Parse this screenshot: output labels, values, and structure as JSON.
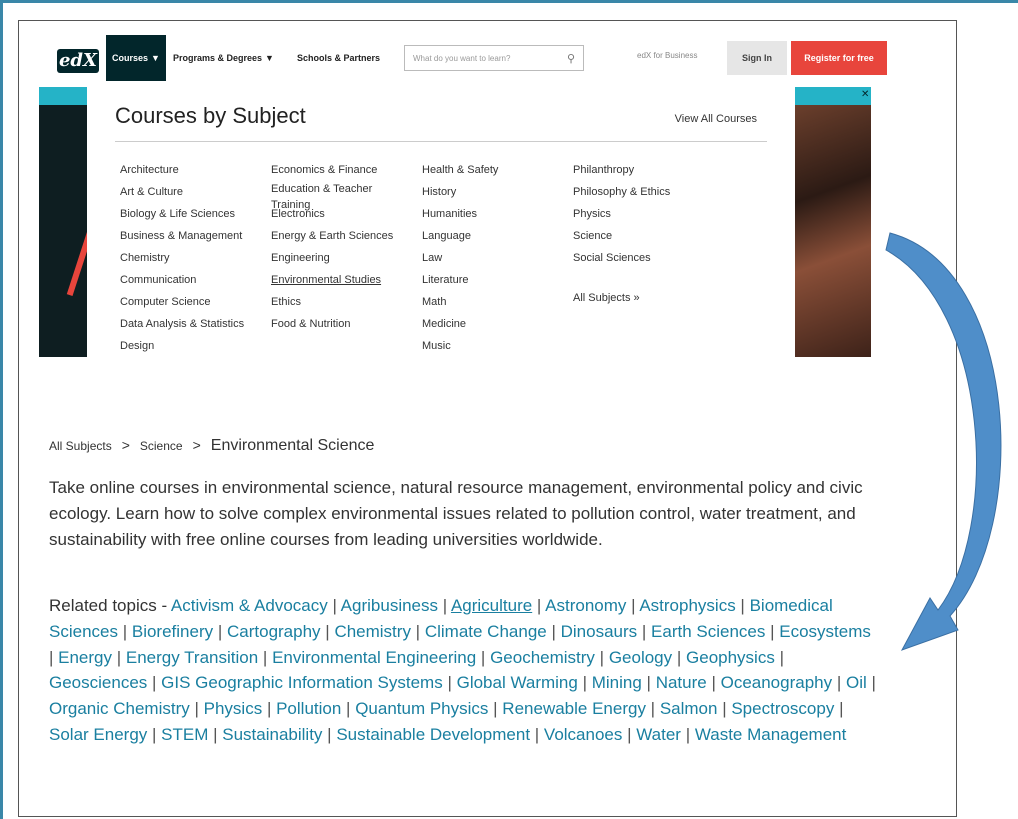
{
  "header": {
    "logo_text": "edX",
    "nav": {
      "courses": "Courses",
      "programs": "Programs & Degrees",
      "schools": "Schools & Partners"
    },
    "search_placeholder": "What do you want to learn?",
    "business_link": "edX for Business",
    "signin": "Sign In",
    "register": "Register for free"
  },
  "dropdown": {
    "title": "Courses by Subject",
    "view_all": "View All Courses",
    "columns": [
      [
        "Architecture",
        "Art & Culture",
        "Biology & Life Sciences",
        "Business & Management",
        "Chemistry",
        "Communication",
        "Computer Science",
        "Data Analysis & Statistics",
        "Design"
      ],
      [
        "Economics & Finance",
        "Education & Teacher Training",
        "Electronics",
        "Energy & Earth Sciences",
        "Engineering",
        "Environmental Studies",
        "Ethics",
        "Food & Nutrition"
      ],
      [
        "Health & Safety",
        "History",
        "Humanities",
        "Language",
        "Law",
        "Literature",
        "Math",
        "Medicine",
        "Music"
      ],
      [
        "Philanthropy",
        "Philosophy & Ethics",
        "Physics",
        "Science",
        "Social Sciences",
        "All Subjects »"
      ]
    ]
  },
  "breadcrumb": {
    "items": [
      "All Subjects",
      "Science"
    ],
    "current": "Environmental Science",
    "separator": ">"
  },
  "description": "Take online courses in environmental science, natural resource management, environmental policy and civic ecology. Learn how to solve complex environmental issues related to pollution control, water treatment, and sustainability with free online courses from leading universities worldwide.",
  "related": {
    "label": "Related topics - ",
    "topics": [
      "Activism & Advocacy",
      "Agribusiness",
      "Agriculture",
      "Astronomy",
      "Astrophysics",
      "Biomedical Sciences",
      "Biorefinery",
      "Cartography",
      "Chemistry",
      "Climate Change",
      "Dinosaurs",
      "Earth Sciences",
      "Ecosystems",
      "Energy",
      "Energy Transition",
      "Environmental Engineering",
      "Geochemistry",
      "Geology",
      "Geophysics",
      "Geosciences",
      "GIS Geographic Information Systems",
      "Global Warming",
      "Mining",
      "Nature",
      "Oceanography",
      "Oil",
      "Organic Chemistry",
      "Physics",
      "Pollution",
      "Quantum Physics",
      "Renewable Energy",
      "Salmon",
      "Spectroscopy",
      "Solar Energy",
      "STEM",
      "Sustainability",
      "Sustainable Development",
      "Volcanoes",
      "Water",
      "Waste Management"
    ],
    "separator": "|"
  },
  "colors": {
    "brand_dark": "#02262b",
    "accent_red": "#e8453c",
    "accent_teal": "#25b3c7",
    "link_blue": "#1a7fa0",
    "frame_blue": "#3a87a8",
    "arrow_blue": "#4f8ec9"
  },
  "icons": [
    "chevron-down-icon",
    "search-icon",
    "close-icon",
    "curved-arrow-icon"
  ]
}
